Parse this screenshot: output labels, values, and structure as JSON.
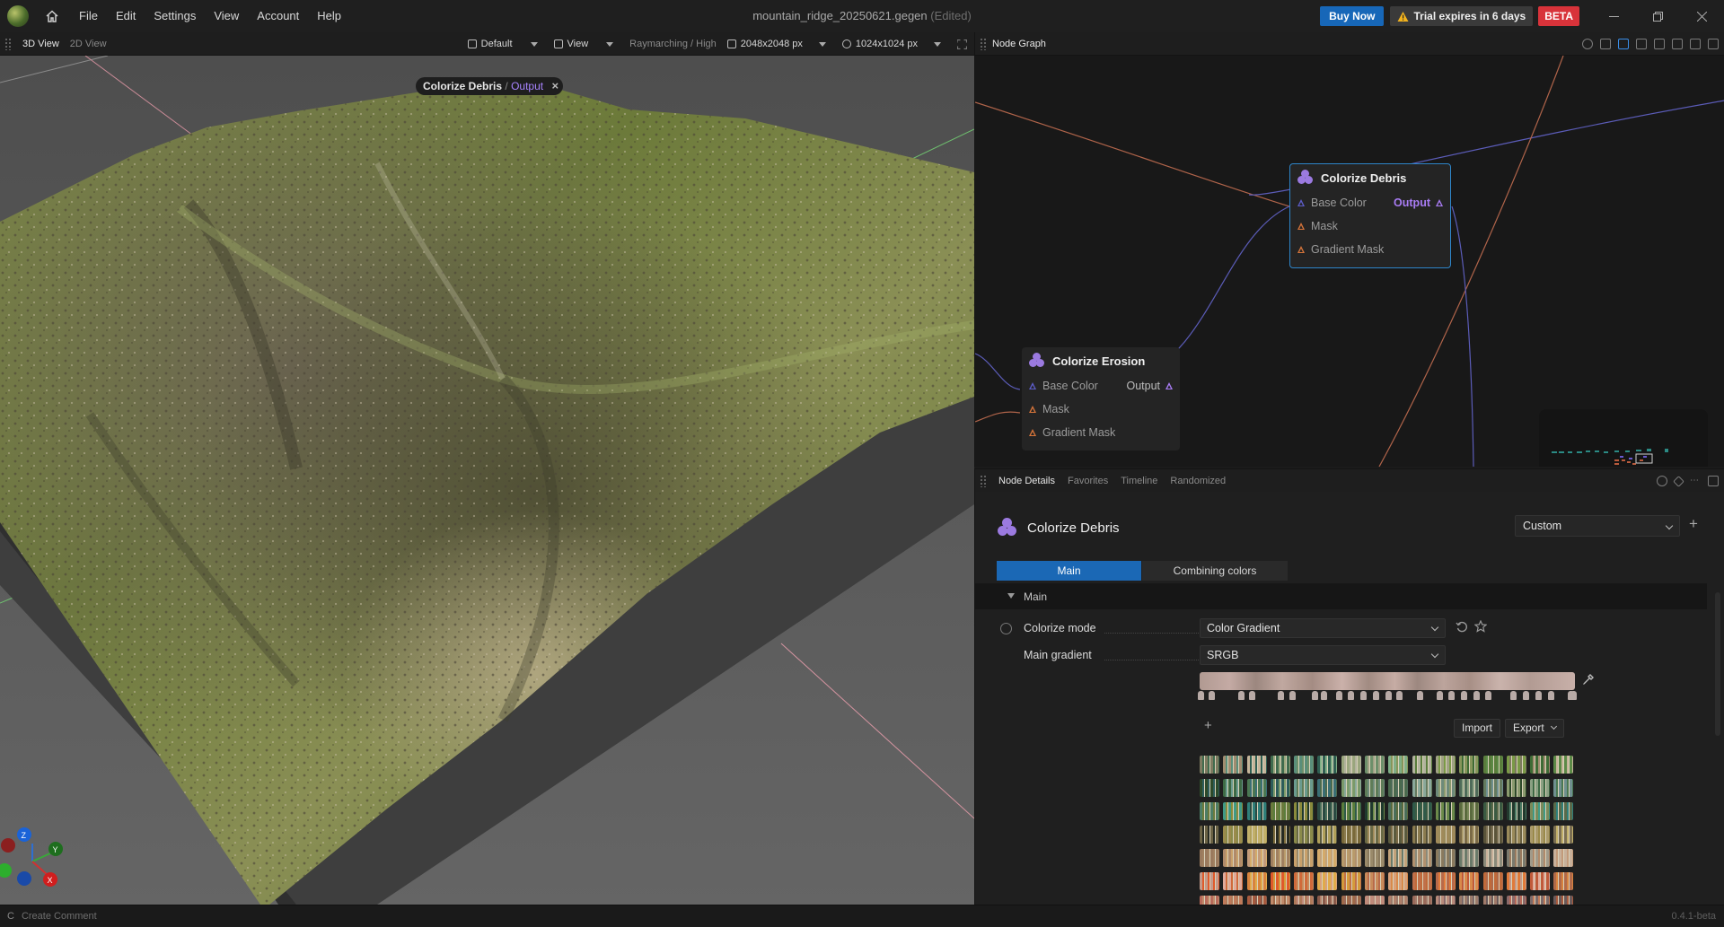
{
  "titlebar": {
    "menu": [
      "File",
      "Edit",
      "Settings",
      "View",
      "Account",
      "Help"
    ],
    "doc_name": "mountain_ridge_20250621.gegen",
    "doc_state": "(Edited)",
    "buy_label": "Buy Now",
    "trial_label": "Trial expires in 6 days",
    "beta_label": "BETA"
  },
  "view3d": {
    "tabs": [
      "3D View",
      "2D View"
    ],
    "preset": "Default",
    "view_label": "View",
    "render_mode": "Raymarching / High",
    "resolution": "2048x2048 px",
    "preview_resolution": "1024x1024 px",
    "breadcrumb_node": "Colorize Debris",
    "breadcrumb_sep": "/",
    "breadcrumb_port": "Output",
    "gizmo_axes": {
      "x": "X",
      "y": "Y",
      "z": "Z"
    }
  },
  "nodegraph": {
    "title": "Node Graph",
    "nodes": [
      {
        "name": "Colorize Debris",
        "inputs": [
          "Base Color",
          "Mask",
          "Gradient Mask"
        ],
        "output": "Output",
        "selected": true
      },
      {
        "name": "Colorize Erosion",
        "inputs": [
          "Base Color",
          "Mask",
          "Gradient Mask"
        ],
        "output": "Output",
        "selected": false
      }
    ]
  },
  "details": {
    "tabs": [
      "Node Details",
      "Favorites",
      "Timeline",
      "Randomized"
    ],
    "node_name": "Colorize Debris",
    "preset": "Custom",
    "subtabs": [
      "Main",
      "Combining colors"
    ],
    "section": "Main",
    "params": {
      "colorize_mode": {
        "label": "Colorize mode",
        "value": "Color Gradient"
      },
      "main_gradient": {
        "label": "Main gradient",
        "value": "SRGB"
      }
    },
    "gradient_stops_count": 26,
    "import_label": "Import",
    "export_label": "Export"
  },
  "colors": {
    "accent_blue": "#1b68b5",
    "beta_red": "#d8333a",
    "output_purple": "#a884ff",
    "port_orange": "#d6743a",
    "port_blue": "#5c5cc8"
  },
  "statusbar": {
    "key": "C",
    "command": "Create Comment",
    "version": "0.4.1-beta"
  }
}
